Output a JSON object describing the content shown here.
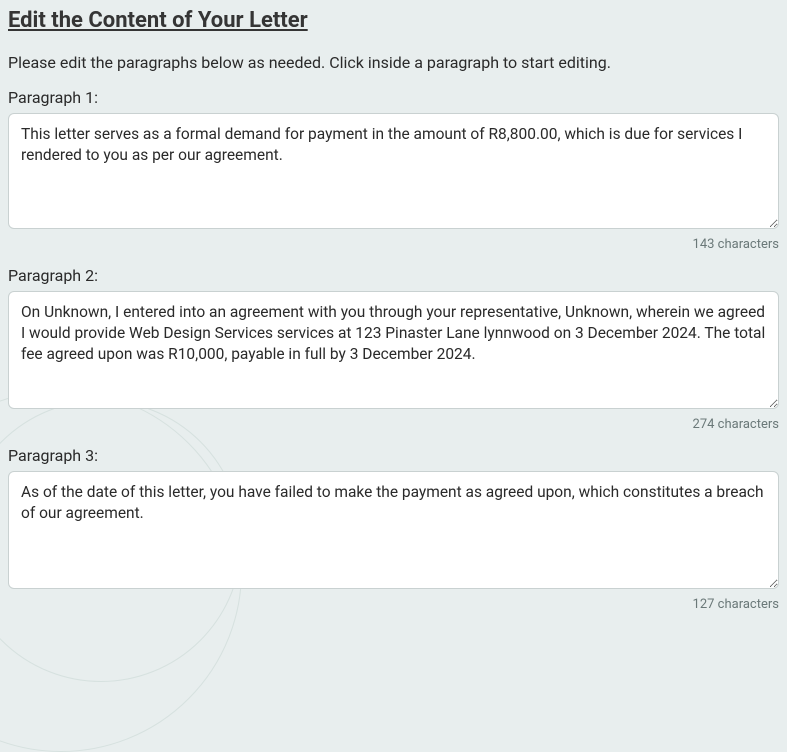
{
  "header": {
    "title": "Edit the Content of Your Letter",
    "instructions": "Please edit the paragraphs below as needed. Click inside a paragraph to start editing."
  },
  "paragraphs": [
    {
      "label": "Paragraph 1:",
      "value": "This letter serves as a formal demand for payment in the amount of R8,800.00, which is due for services I rendered to you as per our agreement.",
      "char_count": "143 characters"
    },
    {
      "label": "Paragraph 2:",
      "value": "On Unknown, I entered into an agreement with you through your representative, Unknown, wherein we agreed I would provide Web Design Services services at 123 Pinaster Lane lynnwood on 3 December 2024. The total fee agreed upon was R10,000, payable in full by 3 December 2024.",
      "char_count": "274 characters"
    },
    {
      "label": "Paragraph 3:",
      "value": "As of the date of this letter, you have failed to make the payment as agreed upon, which constitutes a breach of our agreement.",
      "char_count": "127 characters"
    }
  ]
}
